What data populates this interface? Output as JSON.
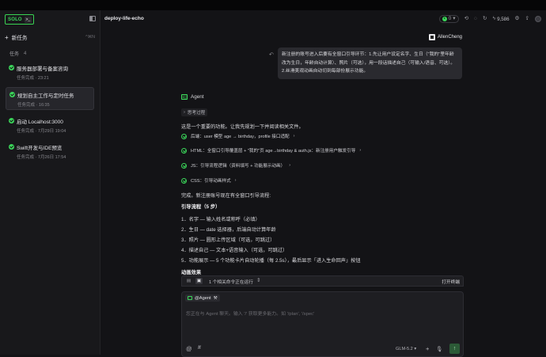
{
  "logo": {
    "text": "SOLO",
    "icon": "code-box-icon"
  },
  "sidebar": {
    "new_task": "新任务",
    "new_task_kbd": "^⌘N",
    "tasks_heading": "任务",
    "tasks_count": "4",
    "tasks": [
      {
        "title": "服务器部署与备案咨询",
        "meta": "任务完成 · 23:21"
      },
      {
        "title": "规划自主工作与定时任务",
        "meta": "任务完成 · 16:35"
      },
      {
        "title": "启动 Localhost:3000",
        "meta": "任务完成 · 7月29日 19:04"
      },
      {
        "title": "Swift开发与IDE预览",
        "meta": "任务完成 · 7月26日 17:54"
      }
    ]
  },
  "header": {
    "project": "deploy-life-echo",
    "run_count": "0",
    "credits": "9,586"
  },
  "chat": {
    "user_name": "AllenCheng",
    "user_message": "新注册的账号进入后要有全窗口引导环节：1.先让用户设定名字、生日（\"我的\"里年龄改为生日，年龄自动计算）、照片（可选），用一段话描述自己（可输入/语音、可选）。2.丝滑美观动画自动切到每部份展示功能。",
    "agent_name": "Agent",
    "thinking": "思考过程",
    "intro": "这是一个重要的功能。让我先规划一下并阅读相关文件。",
    "steps": [
      "后端：user 模型 age → birthday，profile 接口适配",
      "HTML：全窗口引导覆盖层 + \"我的\"页 age→birthday & auth.js：新注册用户触发引导",
      "JS：引导流程逻辑（资料填写 + 功能展示动画）",
      "CSS：引导动画样式"
    ],
    "done_line": "完成。新注册账号现在有全窗口引导流程:",
    "flow_heading": "引导流程（5 步）",
    "flow_items": [
      "1．名字 — 输入姓名或称呼（必填）",
      "2．生日 — date 选择器，后端自动计算年龄",
      "3．照片 — 圆形上传区域（可选，可跳过）",
      "4．描述自己 — 文本+语音输入（可选，可跳过）",
      "5．功能展示 — 5 个功能卡片自动轮播（每 2.5s），最后显示「进入生命回声」按钮"
    ],
    "anim_heading": "动画效果"
  },
  "composer": {
    "run_status": "1 个相关命令正在运行",
    "open_terminal": "打开终端",
    "mention": "@Agent",
    "placeholder": "您正在与 Agent 聊天。输入 '/' 获取更多能力。如 '/plan', '/spec'",
    "model": "GLM-5.2"
  }
}
